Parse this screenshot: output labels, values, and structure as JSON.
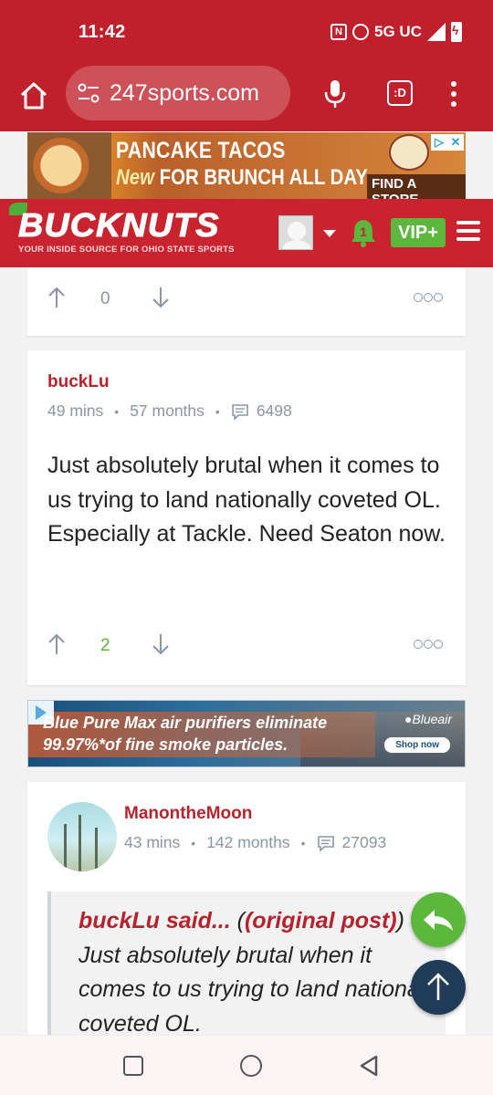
{
  "status_bar": {
    "time": "11:42",
    "nfc": "N",
    "network": "5G UC"
  },
  "browser": {
    "url": "247sports.com",
    "tab_label": ":D"
  },
  "top_ad": {
    "line1": "PANCAKE TACOS",
    "line2_italic": "New",
    "line2_rest": " FOR BRUNCH ALL DAY",
    "cta": "FIND A STORE",
    "close": [
      "▷",
      "✕"
    ]
  },
  "site_header": {
    "logo": "BUCKNUTS",
    "tagline": "YOUR INSIDE SOURCE FOR OHIO STATE SPORTS",
    "notification_count": "1",
    "vip_label": "VIP+"
  },
  "posts": [
    {
      "votes": "0"
    },
    {
      "author": "buckLu",
      "time": "49 mins",
      "tenure": "57 months",
      "post_count": "6498",
      "body": "Just absolutely brutal when it comes to us trying to land nationally coveted OL. Especially at Tackle. Need Seaton now.",
      "votes": "2"
    },
    {
      "author": "ManontheMoon",
      "time": "43 mins",
      "tenure": "142 months",
      "post_count": "27093",
      "quote_author": "buckLu said...",
      "quote_link": "(original post)",
      "quote_body": "Just absolutely brutal when it comes to us trying to land nationally coveted OL."
    }
  ],
  "mid_ad": {
    "line1": "Blue Pure Max air purifiers eliminate",
    "line2": "99.97%*of fine smoke particles.",
    "brand": "●Blueair",
    "cta": "Shop now"
  },
  "meta_separator": "•",
  "colors": {
    "brand_red": "#c0202b",
    "accent_green": "#5cb83c",
    "author_red": "#b5232d",
    "meta_gray": "#8a96a6",
    "navy": "#1f3b57"
  }
}
